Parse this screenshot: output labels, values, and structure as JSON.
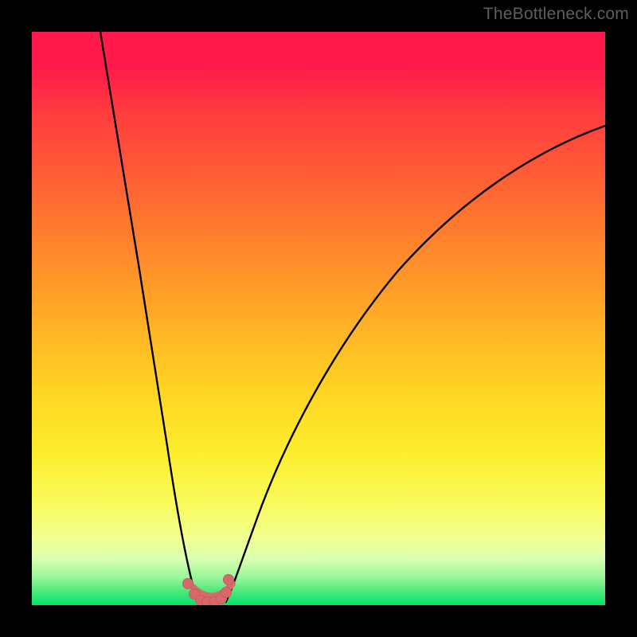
{
  "watermark": "TheBottleneck.com",
  "accent": {
    "marker_fill": "#d66a6a",
    "marker_stroke": "#c85c5c",
    "curve_stroke": "#000000"
  },
  "chart_data": {
    "type": "line",
    "title": "",
    "xlabel": "",
    "ylabel": "",
    "xlim": [
      0,
      100
    ],
    "ylim": [
      0,
      100
    ],
    "grid": false,
    "legend": false,
    "series": [
      {
        "name": "left-branch",
        "x": [
          12,
          14,
          16,
          18,
          20,
          22,
          24,
          25.5,
          27,
          28,
          28.7
        ],
        "y": [
          100,
          86,
          72,
          58,
          44,
          31,
          19,
          11,
          5.5,
          2.2,
          0.8
        ]
      },
      {
        "name": "right-branch",
        "x": [
          33.2,
          34,
          36,
          38,
          41,
          45,
          50,
          56,
          63,
          71,
          80,
          90,
          100
        ],
        "y": [
          0.8,
          2.0,
          8,
          15,
          24,
          34,
          44,
          53,
          61,
          68,
          74,
          79.5,
          84
        ]
      },
      {
        "name": "valley-markers",
        "type": "scatter",
        "x": [
          27.2,
          28.3,
          29.4,
          30.6,
          31.8,
          33.0,
          33.8,
          34.3
        ],
        "y": [
          3.8,
          1.9,
          0.9,
          0.6,
          0.7,
          1.1,
          2.2,
          4.4
        ]
      }
    ]
  }
}
